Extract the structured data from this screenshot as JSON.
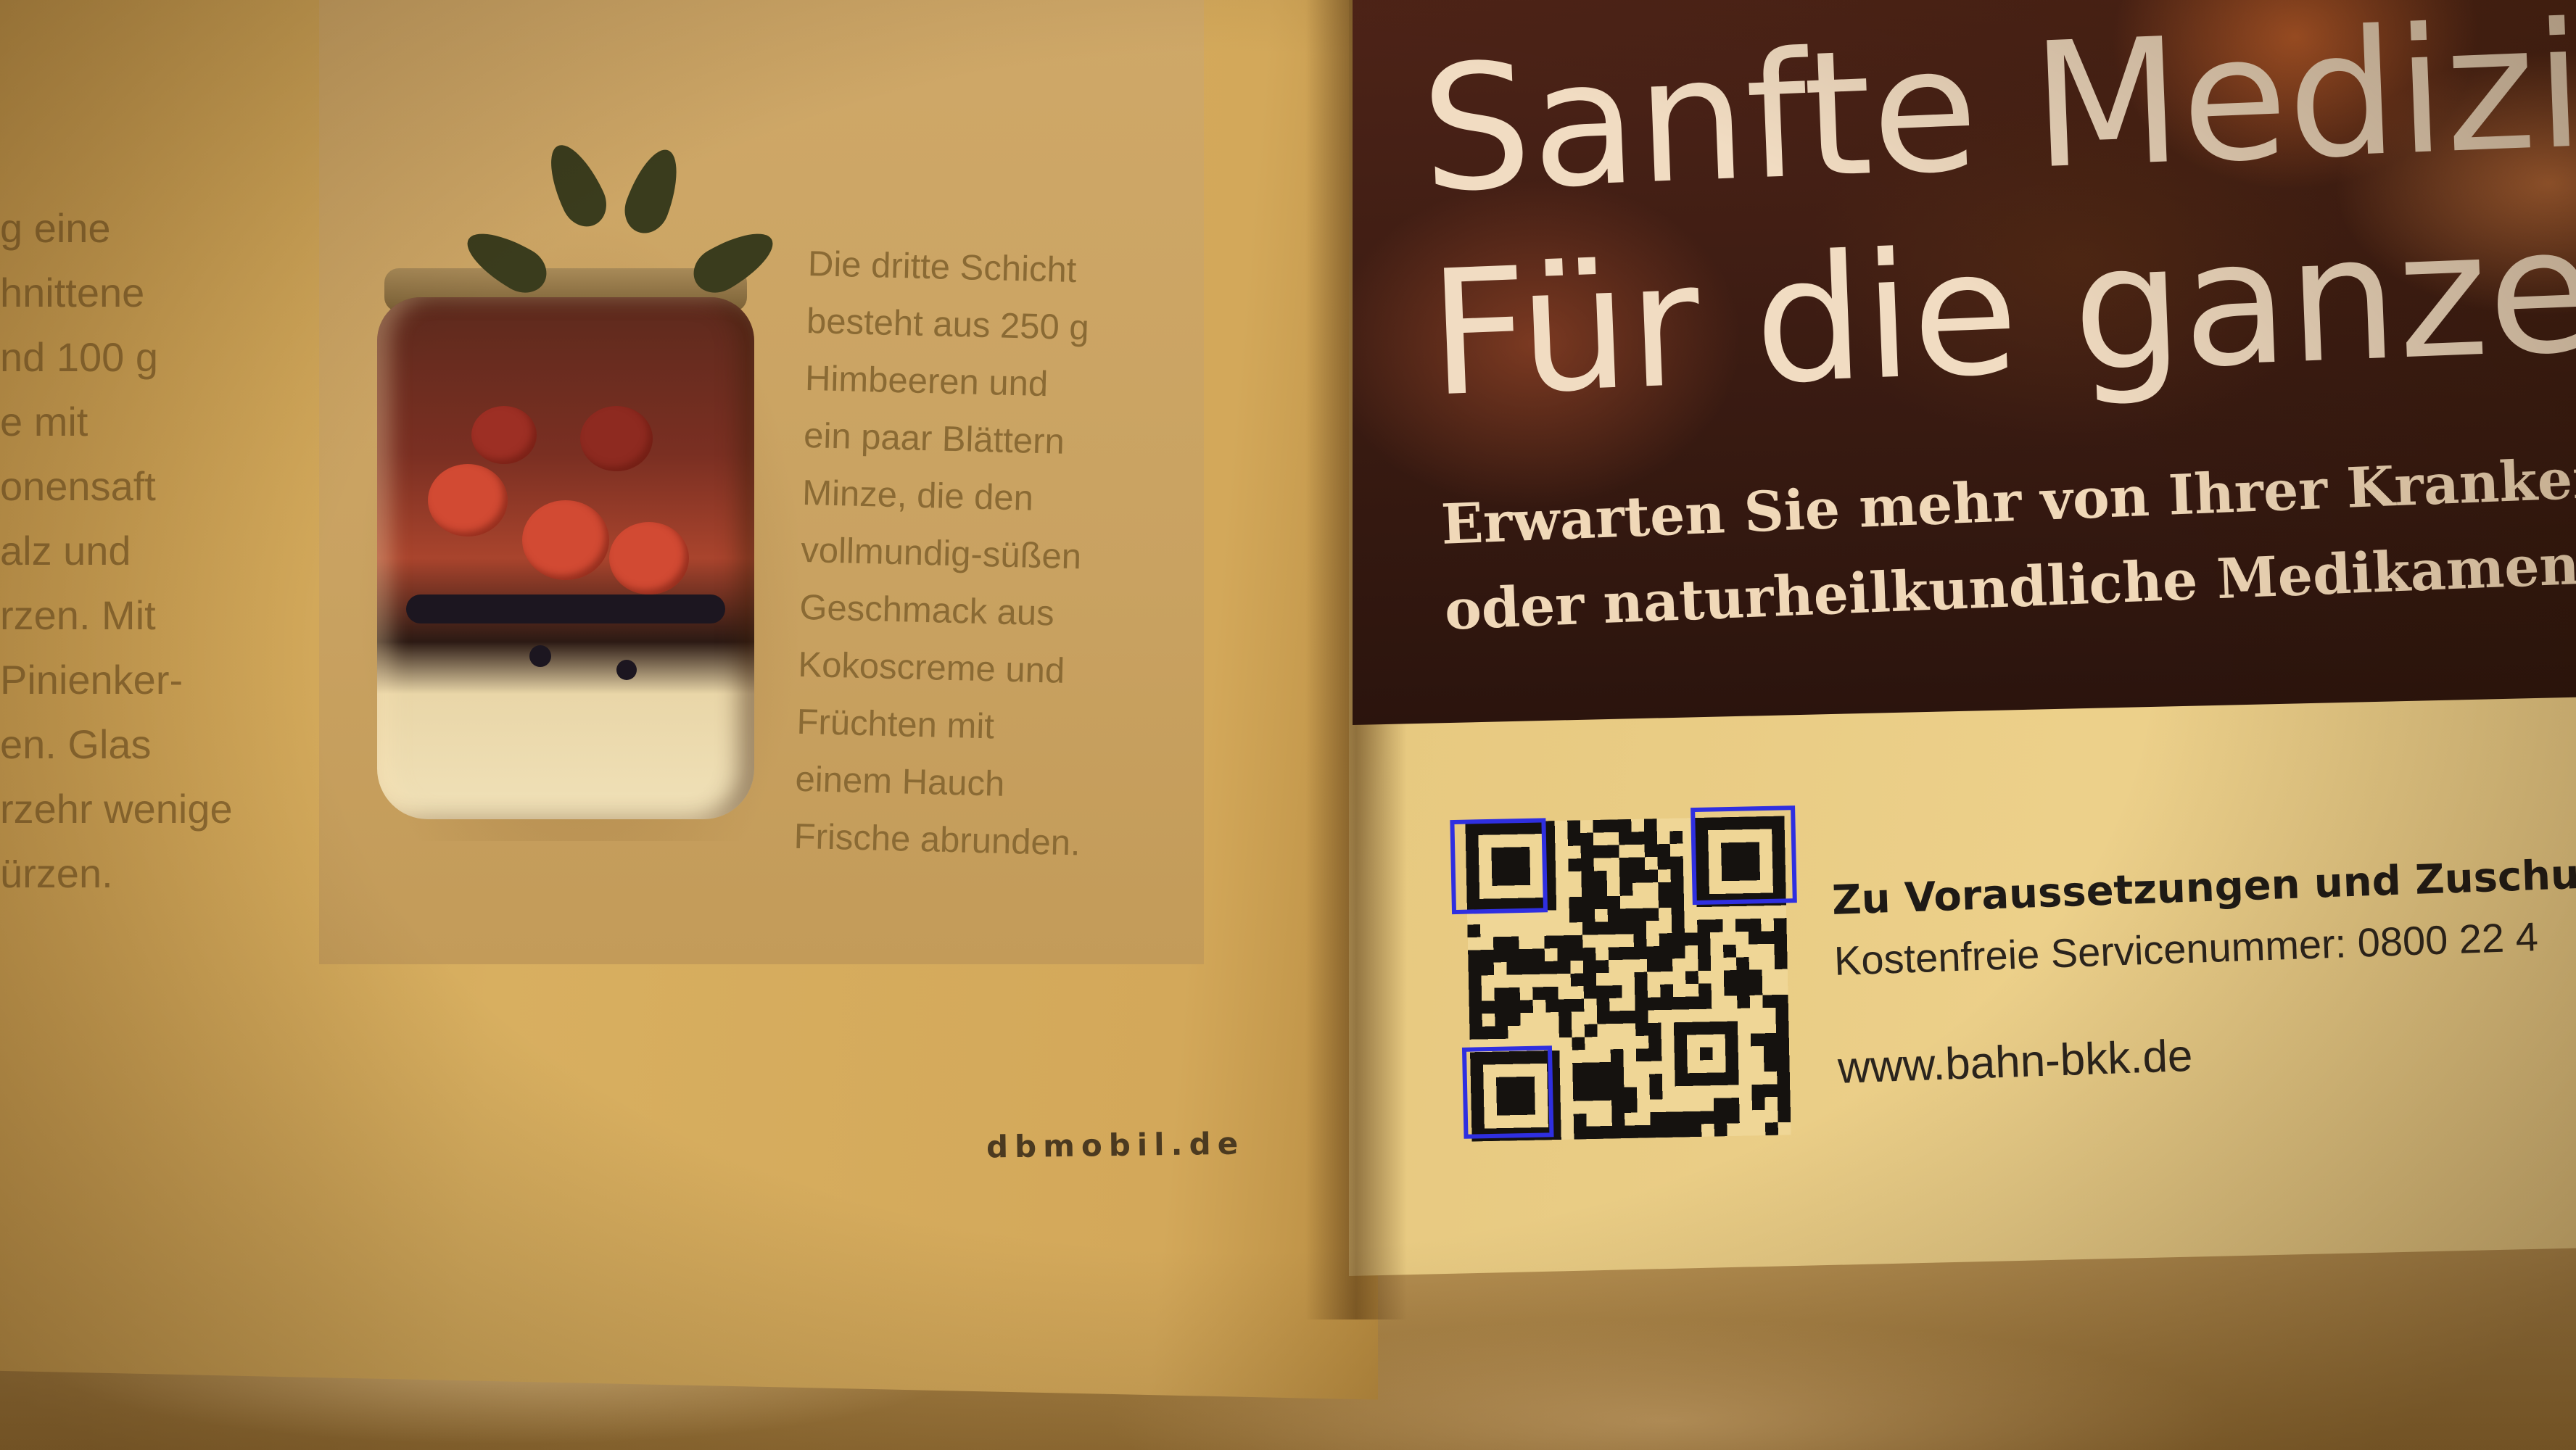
{
  "left_page": {
    "column_fragments": [
      "g eine",
      "hnittene",
      "nd 100 g",
      "e mit",
      "onensaft",
      "alz und",
      "rzen. Mit",
      "Pinienker-",
      "en. Glas",
      "rzehr wenige",
      "ürzen."
    ],
    "jar_caption": [
      "Die dritte Schicht",
      "besteht aus 250 g",
      "Himbeeren und",
      "ein paar Blättern",
      "Minze, die den",
      "vollmundig-süßen",
      "Geschmack aus",
      "Kokoscreme und",
      "Früchten mit",
      "einem Hauch",
      "Frische abrunden."
    ],
    "footer": "dbmobil.de"
  },
  "right_page": {
    "headline": [
      "Sanfte Medizin",
      "Für die ganze"
    ],
    "subline": [
      "Erwarten Sie mehr von Ihrer Krankenka",
      "oder naturheilkundliche Medikamente:"
    ],
    "info_bold": "Zu Voraussetzungen und Zuschusshö",
    "info_phone": "Kostenfreie Servicenummer: 0800 22 4",
    "website": "www.bahn-bkk.de"
  },
  "annotation_color": "#2f2fe0"
}
